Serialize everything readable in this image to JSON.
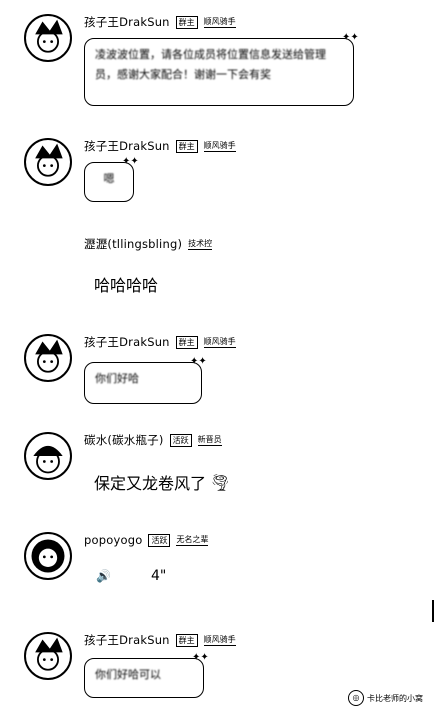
{
  "messages": [
    {
      "username": "孩子王DrakSun",
      "badge1": "群主",
      "badge2": "顺风骑手",
      "text": "凌波波位置，请各位成员将位置信息发送给管理员，感谢大家配合！谢谢一下会有奖"
    },
    {
      "username": "孩子王DrakSun",
      "badge1": "群主",
      "badge2": "顺风骑手",
      "text": "嗯"
    },
    {
      "username": "瀝瀝(tllingsbling)",
      "badge1": "",
      "badge2": "技术控",
      "text": "哈哈哈哈"
    },
    {
      "username": "孩子王DrakSun",
      "badge1": "群主",
      "badge2": "顺风骑手",
      "text": "你们好哈"
    },
    {
      "username": "碳水(碳水瓶子)",
      "badge1": "活跃",
      "badge2": "新晋员",
      "text": "保定又龙卷风了"
    },
    {
      "username": "popoyogo",
      "badge1": "活跃",
      "badge2": "无名之辈",
      "voice_duration": "4\""
    },
    {
      "username": "孩子王DrakSun",
      "badge1": "群主",
      "badge2": "顺风骑手",
      "text": "你们好哈可以"
    }
  ],
  "icons": {
    "speaker": "speaker-icon",
    "emoji": "tornado-emoji-icon"
  },
  "emoji_glyph": "🌪",
  "speaker_glyph": "🔊",
  "watermark": "卡比老师的小窝"
}
